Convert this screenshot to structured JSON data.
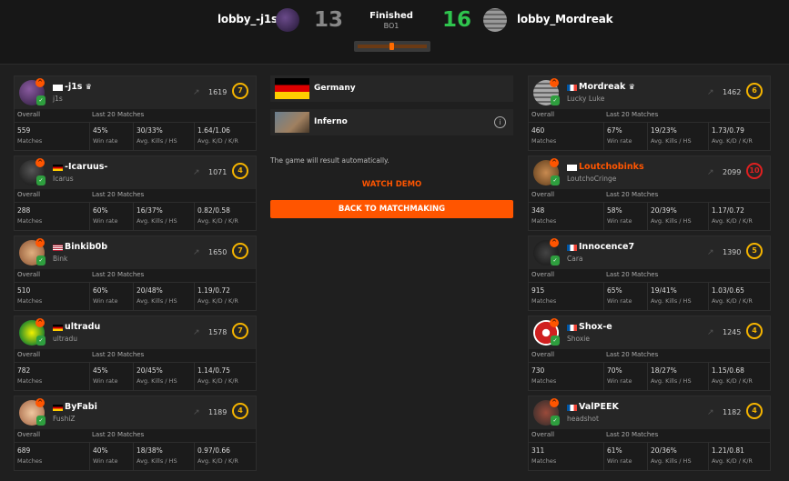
{
  "header": {
    "team_left": "lobby_-j1s",
    "score_left": "13",
    "status": "Finished",
    "format": "BO1",
    "score_right": "16",
    "team_right": "lobby_Mordreak"
  },
  "colors": {
    "accent": "#ff5500",
    "score_win": "#2fc44e",
    "score_loss": "#888888",
    "bg": "#1f1f1f"
  },
  "columns": {
    "overall": "Overall",
    "last20": "Last 20 Matches",
    "matches": "Matches",
    "winrate": "Win rate",
    "kills_hs": "Avg. Kills / HS",
    "kd_kr": "Avg. K/D / K/R"
  },
  "left_team": [
    {
      "name": "-j1s",
      "real": "j1s",
      "elo": "1619",
      "level": "7",
      "matches": "559",
      "winrate": "45%",
      "kills": "30/33%",
      "kd": "1.64/1.06",
      "flag": "jp"
    },
    {
      "name": "-Icaruus-",
      "real": "Icarus",
      "elo": "1071",
      "level": "4",
      "matches": "288",
      "winrate": "60%",
      "kills": "16/37%",
      "kd": "0.82/0.58",
      "flag": "de"
    },
    {
      "name": "Binkib0b",
      "real": "Bink",
      "elo": "1650",
      "level": "7",
      "matches": "510",
      "winrate": "60%",
      "kills": "20/48%",
      "kd": "1.19/0.72",
      "flag": "us"
    },
    {
      "name": "ultradu",
      "real": "ultradu",
      "elo": "1578",
      "level": "7",
      "matches": "782",
      "winrate": "45%",
      "kills": "20/45%",
      "kd": "1.14/0.75",
      "flag": "de"
    },
    {
      "name": "ByFabi",
      "real": "FushiZ",
      "elo": "1189",
      "level": "4",
      "matches": "689",
      "winrate": "40%",
      "kills": "18/38%",
      "kd": "0.97/0.66",
      "flag": "de"
    }
  ],
  "right_team": [
    {
      "name": "Mordreak",
      "real": "Lucky Luke",
      "elo": "1462",
      "level": "6",
      "matches": "460",
      "winrate": "67%",
      "kills": "19/23%",
      "kd": "1.73/0.79",
      "flag": "fr"
    },
    {
      "name": "Loutchobinks",
      "real": "LoutchoCringe",
      "elo": "2099",
      "level": "10",
      "matches": "348",
      "winrate": "58%",
      "kills": "20/39%",
      "kd": "1.17/0.72",
      "flag": "jp"
    },
    {
      "name": "Innocence7",
      "real": "Cara",
      "elo": "1390",
      "level": "5",
      "matches": "915",
      "winrate": "65%",
      "kills": "19/41%",
      "kd": "1.03/0.65",
      "flag": "fr"
    },
    {
      "name": "Shox-e",
      "real": "Shoxie",
      "elo": "1245",
      "level": "4",
      "matches": "730",
      "winrate": "70%",
      "kills": "18/27%",
      "kd": "1.15/0.68",
      "flag": "fr"
    },
    {
      "name": "ValPEEK",
      "real": "headshot",
      "elo": "1182",
      "level": "4",
      "matches": "311",
      "winrate": "61%",
      "kills": "20/36%",
      "kd": "1.21/0.81",
      "flag": "fr"
    }
  ],
  "center": {
    "server": "Germany",
    "map": "Inferno",
    "notice": "The game will result automatically.",
    "watch_demo": "WATCH DEMO",
    "back": "BACK TO MATCHMAKING"
  }
}
